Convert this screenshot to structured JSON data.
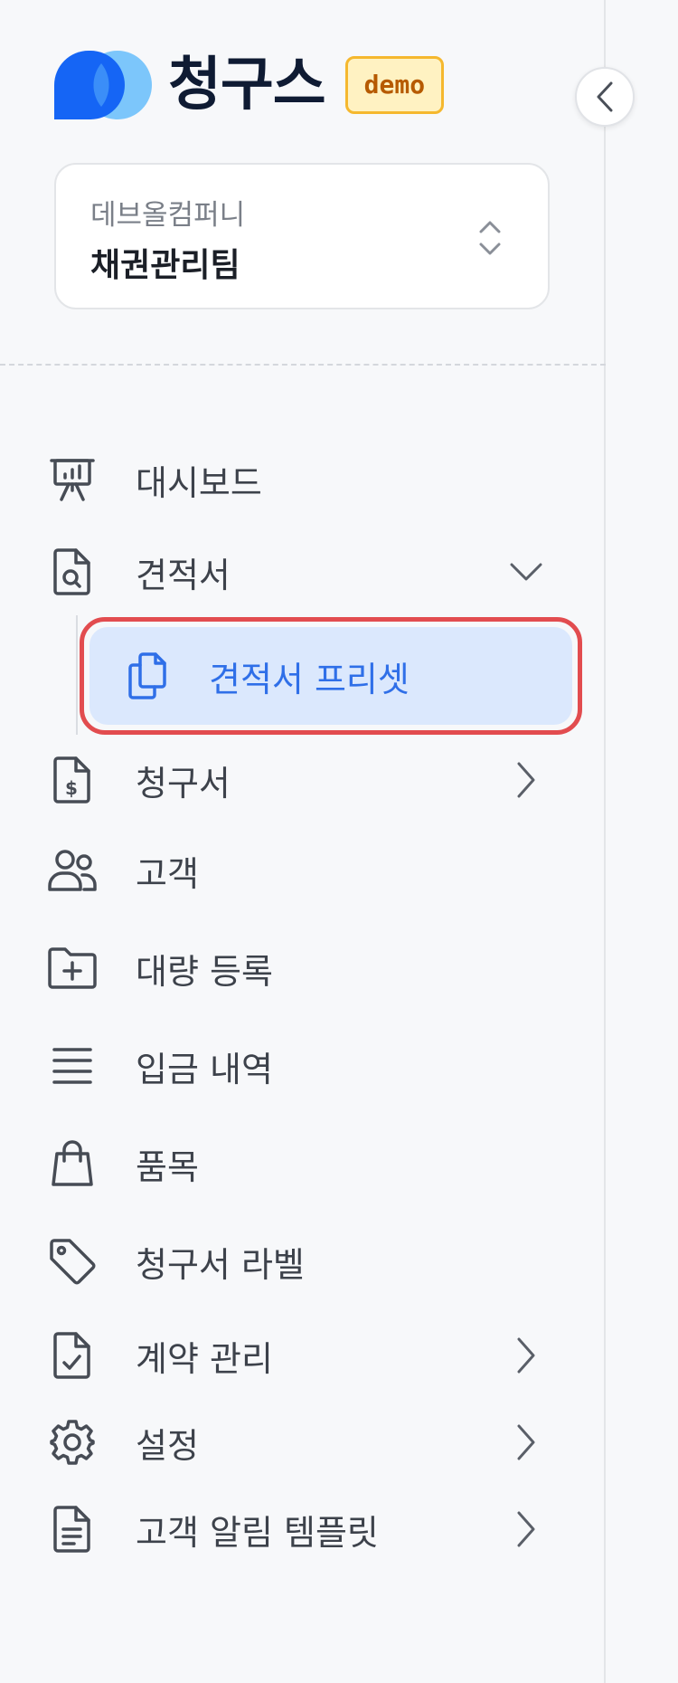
{
  "brand": {
    "name": "청구스",
    "badge": "demo",
    "logo_icon": "brand-logo-icon"
  },
  "collapse_button": {
    "icon": "chevron-left-icon"
  },
  "org": {
    "company": "데브올컴퍼니",
    "team": "채권관리팀",
    "icon": "chevron-up-down-icon"
  },
  "nav": {
    "dashboard": {
      "label": "대시보드",
      "icon": "presentation-chart-icon"
    },
    "quotes": {
      "label": "견적서",
      "icon": "document-search-icon",
      "expanded": true
    },
    "quote_presets": {
      "label": "견적서 프리셋",
      "icon": "copy-documents-icon",
      "active": true
    },
    "invoices": {
      "label": "청구서",
      "icon": "document-dollar-icon"
    },
    "customers": {
      "label": "고객",
      "icon": "users-icon"
    },
    "bulk_register": {
      "label": "대량 등록",
      "icon": "folder-plus-icon"
    },
    "deposits": {
      "label": "입금 내역",
      "icon": "list-lines-icon"
    },
    "items": {
      "label": "품목",
      "icon": "shopping-bag-icon"
    },
    "invoice_labels": {
      "label": "청구서 라벨",
      "icon": "tag-icon"
    },
    "contracts": {
      "label": "계약 관리",
      "icon": "document-check-icon"
    },
    "settings": {
      "label": "설정",
      "icon": "gear-icon"
    },
    "notification_templates": {
      "label": "고객 알림 템플릿",
      "icon": "document-text-icon"
    }
  },
  "colors": {
    "accent": "#2f6fe8",
    "active_bg": "#dbe8fd",
    "highlight_border": "#e24c4f",
    "text": "#3d424b",
    "brand_dark": "#0f1b33",
    "logo_blue": "#1565f5",
    "logo_light_blue": "#7cc6fb"
  }
}
